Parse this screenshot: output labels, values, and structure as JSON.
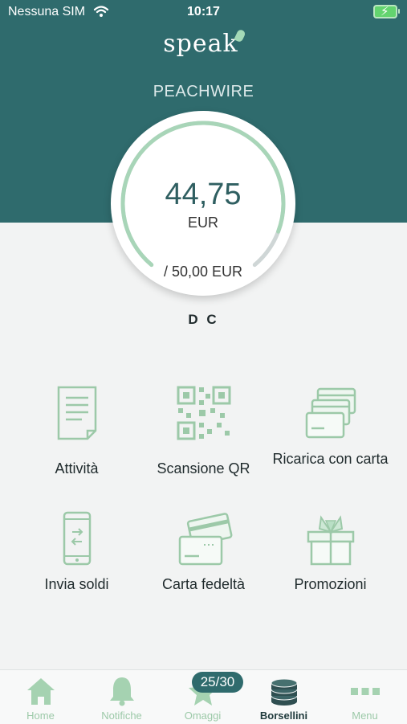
{
  "status_bar": {
    "carrier": "Nessuna SIM",
    "time": "10:17"
  },
  "brand": {
    "logo": "speak"
  },
  "wallet": {
    "name": "PEACHWIRE",
    "balance": "44,75",
    "currency": "EUR",
    "limit": "/ 50,00 EUR",
    "progress_fraction": 0.895,
    "owner": "D C"
  },
  "actions": [
    {
      "label": "Attività",
      "icon": "document-icon"
    },
    {
      "label": "Scansione QR",
      "icon": "qr-code-icon"
    },
    {
      "label": "Ricarica con carta",
      "icon": "cards-icon"
    },
    {
      "label": "Invia soldi",
      "icon": "phone-transfer-icon"
    },
    {
      "label": "Carta fedeltà",
      "icon": "loyalty-card-icon"
    },
    {
      "label": "Promozioni",
      "icon": "gift-icon"
    }
  ],
  "tabbar": {
    "items": [
      {
        "label": "Home",
        "icon": "home-icon"
      },
      {
        "label": "Notifiche",
        "icon": "bell-icon"
      },
      {
        "label": "Omaggi",
        "icon": "star-icon"
      },
      {
        "label": "Borsellini",
        "icon": "coins-icon",
        "active": true
      },
      {
        "label": "Menu",
        "icon": "dots-icon"
      }
    ],
    "omaggi_badge": "25/30"
  },
  "colors": {
    "brand_teal": "#2f6b6d",
    "accent_mint": "#9cc9a8",
    "background": "#f2f3f3"
  }
}
